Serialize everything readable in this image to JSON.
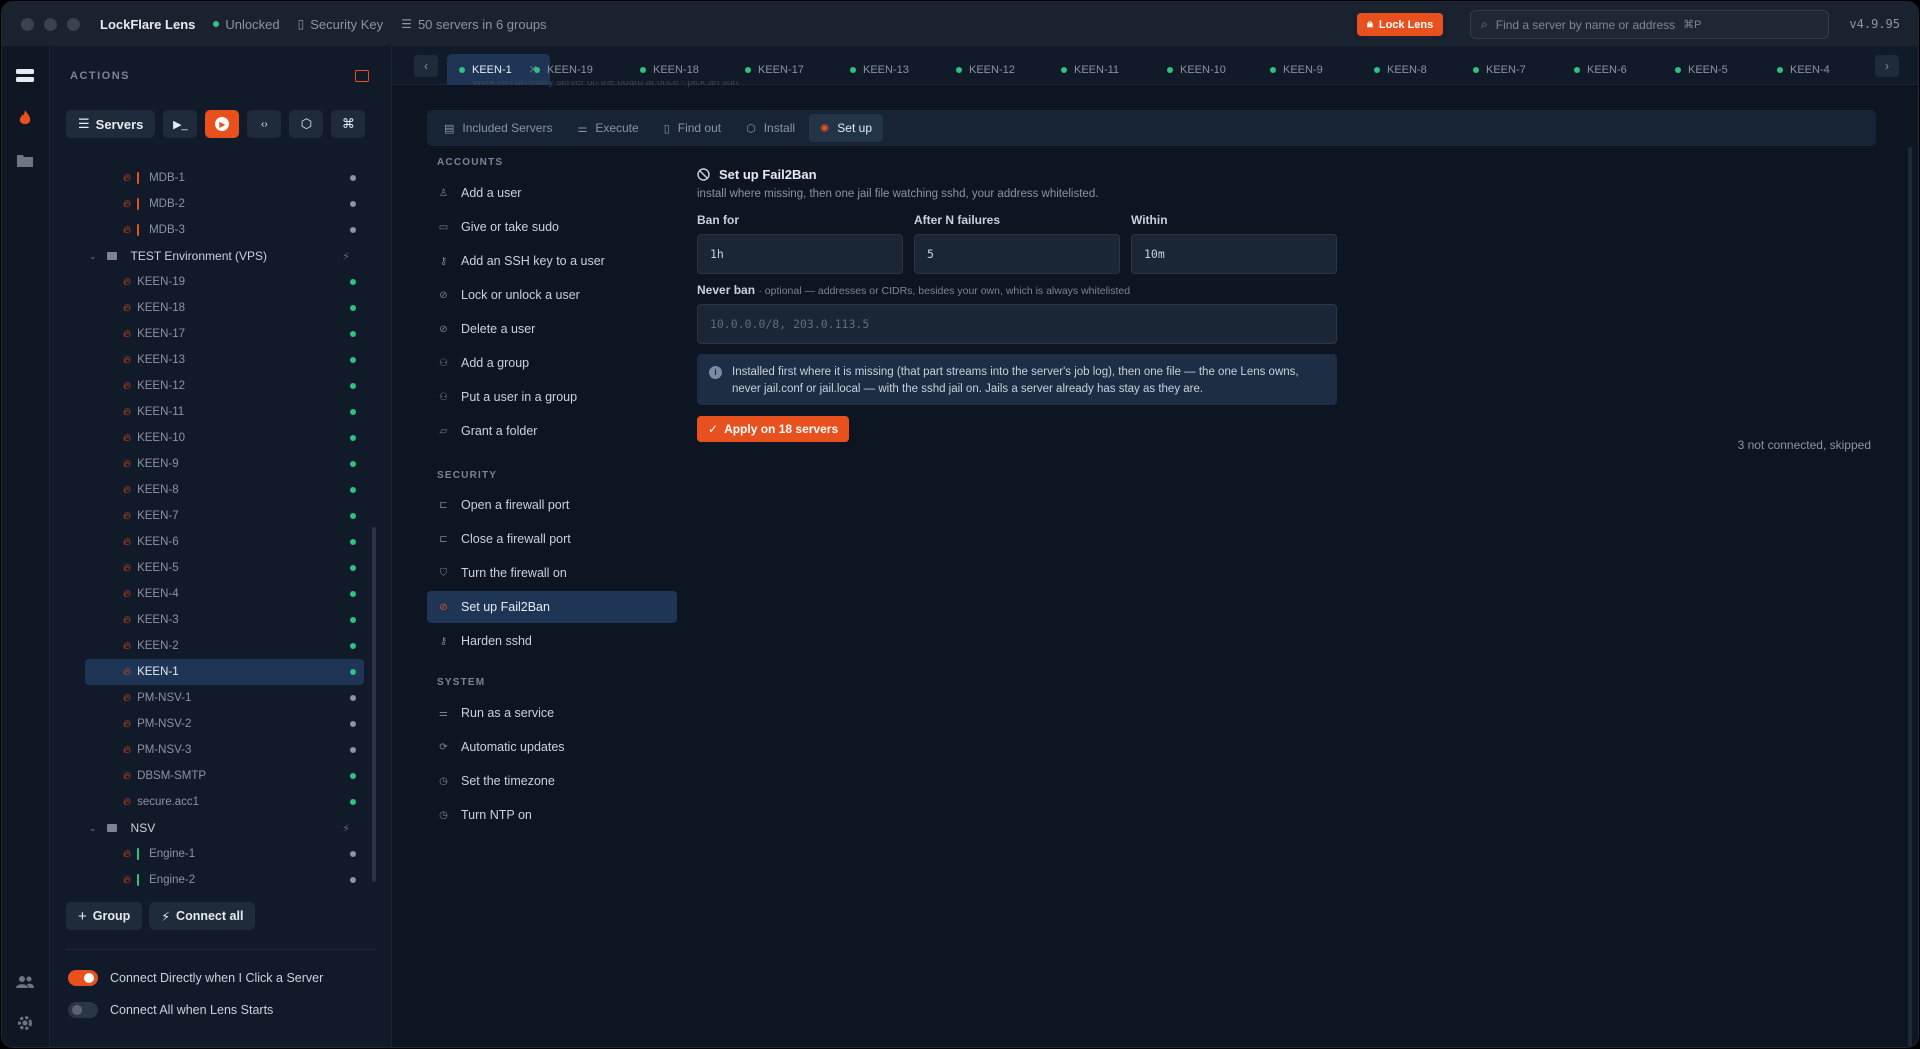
{
  "titlebar": {
    "app_name": "LockFlare Lens",
    "status": "Unlocked",
    "security_key": "Security Key",
    "servers_summary": "50 servers in 6 groups",
    "lock_button": "Lock Lens",
    "search_placeholder": "Find a server by name or address",
    "search_shortcut": "⌘P",
    "version": "v4.9.95"
  },
  "sidebar": {
    "heading": "ACTIONS",
    "toolbar": {
      "servers_label": "Servers"
    },
    "tree": [
      {
        "type": "server",
        "name": "MDB-1",
        "bar": "#e8501d",
        "status": "#8a94a3"
      },
      {
        "type": "server",
        "name": "MDB-2",
        "bar": "#e8501d",
        "status": "#8a94a3"
      },
      {
        "type": "server",
        "name": "MDB-3",
        "bar": "#e8501d",
        "status": "#8a94a3"
      },
      {
        "type": "group",
        "name": "TEST Environment (VPS)"
      },
      {
        "type": "server",
        "name": "KEEN-19",
        "status": "#2ec27e"
      },
      {
        "type": "server",
        "name": "KEEN-18",
        "status": "#2ec27e"
      },
      {
        "type": "server",
        "name": "KEEN-17",
        "status": "#2ec27e"
      },
      {
        "type": "server",
        "name": "KEEN-13",
        "status": "#2ec27e"
      },
      {
        "type": "server",
        "name": "KEEN-12",
        "status": "#2ec27e"
      },
      {
        "type": "server",
        "name": "KEEN-11",
        "status": "#2ec27e"
      },
      {
        "type": "server",
        "name": "KEEN-10",
        "status": "#2ec27e"
      },
      {
        "type": "server",
        "name": "KEEN-9",
        "status": "#2ec27e"
      },
      {
        "type": "server",
        "name": "KEEN-8",
        "status": "#2ec27e"
      },
      {
        "type": "server",
        "name": "KEEN-7",
        "status": "#2ec27e"
      },
      {
        "type": "server",
        "name": "KEEN-6",
        "status": "#2ec27e"
      },
      {
        "type": "server",
        "name": "KEEN-5",
        "status": "#2ec27e"
      },
      {
        "type": "server",
        "name": "KEEN-4",
        "status": "#2ec27e"
      },
      {
        "type": "server",
        "name": "KEEN-3",
        "status": "#2ec27e"
      },
      {
        "type": "server",
        "name": "KEEN-2",
        "status": "#2ec27e"
      },
      {
        "type": "server",
        "name": "KEEN-1",
        "status": "#2ec27e",
        "selected": true
      },
      {
        "type": "server",
        "name": "PM-NSV-1",
        "status": "#8a94a3"
      },
      {
        "type": "server",
        "name": "PM-NSV-2",
        "status": "#8a94a3"
      },
      {
        "type": "server",
        "name": "PM-NSV-3",
        "status": "#8a94a3"
      },
      {
        "type": "server",
        "name": "DBSM-SMTP",
        "status": "#2ec27e"
      },
      {
        "type": "server",
        "name": "secure.acc1",
        "status": "#2ec27e"
      },
      {
        "type": "group",
        "name": "NSV"
      },
      {
        "type": "server",
        "name": "Engine-1",
        "bar": "#2ec27e",
        "status": "#8a94a3"
      },
      {
        "type": "server",
        "name": "Engine-2",
        "bar": "#2ec27e",
        "status": "#8a94a3"
      }
    ],
    "group_button": "Group",
    "connect_all_button": "Connect all",
    "toggle_connect_directly": "Connect Directly when I Click a Server",
    "toggle_connect_all_start": "Connect All when Lens Starts",
    "toggle_connect_directly_on": true,
    "toggle_connect_all_start_on": false
  },
  "tabs": [
    "KEEN-1",
    "KEEN-19",
    "KEEN-18",
    "KEEN-17",
    "KEEN-13",
    "KEEN-12",
    "KEEN-11",
    "KEEN-10",
    "KEEN-9",
    "KEEN-8",
    "KEEN-7",
    "KEEN-6",
    "KEEN-5",
    "KEEN-4"
  ],
  "cutoff_text": "Work run on every server on the board at once · pick an sort",
  "subtabs": [
    {
      "label": "Included Servers",
      "icon": "server-icon"
    },
    {
      "label": "Execute",
      "icon": "sliders-icon"
    },
    {
      "label": "Find out",
      "icon": "document-icon"
    },
    {
      "label": "Install",
      "icon": "package-icon"
    },
    {
      "label": "Set up",
      "icon": "gear-icon",
      "active": true
    }
  ],
  "actions": {
    "sections": [
      {
        "title": "ACCOUNTS",
        "items": [
          "Add a user",
          "Give or take sudo",
          "Add an SSH key to a user",
          "Lock or unlock a user",
          "Delete a user",
          "Add a group",
          "Put a user in a group",
          "Grant a folder"
        ]
      },
      {
        "title": "SECURITY",
        "items": [
          "Open a firewall port",
          "Close a firewall port",
          "Turn the firewall on",
          "Set up Fail2Ban",
          "Harden sshd"
        ]
      },
      {
        "title": "SYSTEM",
        "items": [
          "Run as a service",
          "Automatic updates",
          "Set the timezone",
          "Turn NTP on"
        ]
      }
    ],
    "selected": "Set up Fail2Ban"
  },
  "panel": {
    "title": "Set up Fail2Ban",
    "description": "install where missing, then one jail file watching sshd, your address whitelisted.",
    "ban_for_label": "Ban for",
    "ban_for_value": "1h",
    "after_n_label": "After N failures",
    "after_n_value": "5",
    "within_label": "Within",
    "within_value": "10m",
    "never_ban_label": "Never ban",
    "never_ban_hint": "· optional — addresses or CIDRs, besides your own, which is always whitelisted",
    "never_ban_placeholder": "10.0.0.0/8, 203.0.113.5",
    "info_text": "Installed first where it is missing (that part streams into the server's job log), then one file — the one Lens owns, never jail.conf or jail.local — with the sshd jail on. Jails a server already has stay as they are.",
    "apply_button": "Apply on 18 servers",
    "skipped_text": "3 not connected, skipped"
  }
}
